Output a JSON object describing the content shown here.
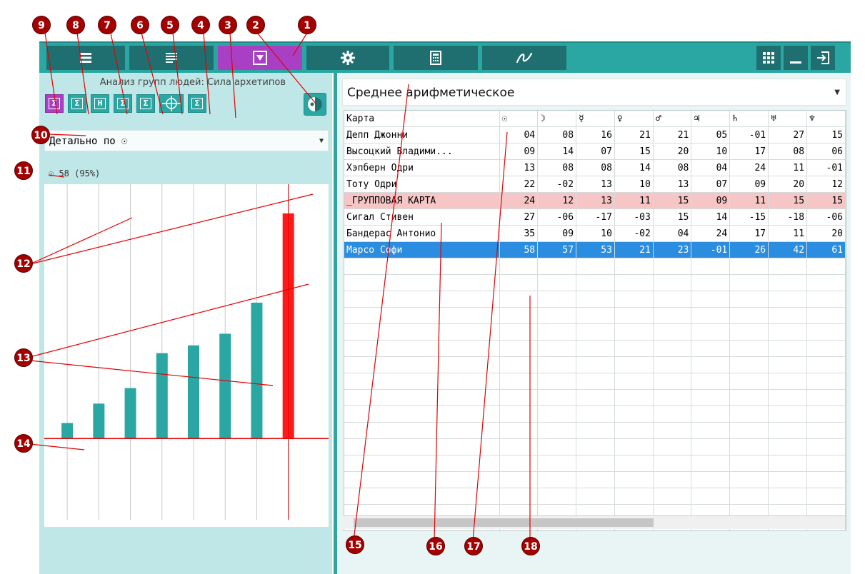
{
  "topbar": {
    "tabs": [
      {
        "icon": "list-icon"
      },
      {
        "icon": "list-lines-icon"
      },
      {
        "icon": "filter-box-icon"
      },
      {
        "icon": "gear-icon"
      },
      {
        "icon": "calculator-icon"
      },
      {
        "icon": "signature-icon"
      }
    ],
    "window_buttons": [
      "grid-icon",
      "minimize-icon",
      "exit-icon"
    ]
  },
  "left": {
    "title": "Анализ групп людей: Сила архетипов",
    "toolbar": [
      {
        "label": "Σ",
        "icon": "sum-icon"
      },
      {
        "label": "Σ",
        "icon": "sum-a-icon"
      },
      {
        "label": "H",
        "icon": "h-icon"
      },
      {
        "label": "Σ",
        "icon": "sum-box-icon"
      },
      {
        "label": "Σ",
        "icon": "sum-grid-icon"
      },
      {
        "label": "⊕",
        "icon": "crosshair-icon"
      },
      {
        "label": "Σ",
        "icon": "sum-bracket-icon"
      },
      {
        "label": "◉",
        "icon": "toggle-icon"
      }
    ],
    "dropdown": "Детально по ☉",
    "sublabel": "☉ 58 (95%)"
  },
  "chart_data": {
    "type": "bar",
    "values": [
      4,
      9,
      13,
      22,
      24,
      27,
      35,
      58
    ],
    "colors": [
      "#2aa7a3",
      "#2aa7a3",
      "#2aa7a3",
      "#2aa7a3",
      "#2aa7a3",
      "#2aa7a3",
      "#2aa7a3",
      "#ff1a1a"
    ],
    "ylim": [
      -20,
      60
    ]
  },
  "right": {
    "select": "Среднее арифметическое",
    "columns": [
      "Карта",
      "☉",
      "☽",
      "☿",
      "♀",
      "♂",
      "♃",
      "♄",
      "♅",
      "♆"
    ],
    "rows": [
      {
        "name": "Депп Джонни",
        "vals": [
          "04",
          "08",
          "16",
          "21",
          "21",
          "05",
          "-01",
          "27",
          "15"
        ],
        "kind": "normal"
      },
      {
        "name": "Высоцкий Владими...",
        "vals": [
          "09",
          "14",
          "07",
          "15",
          "20",
          "10",
          "17",
          "08",
          "06"
        ],
        "kind": "normal"
      },
      {
        "name": "Хэпберн Одри",
        "vals": [
          "13",
          "08",
          "08",
          "14",
          "08",
          "04",
          "24",
          "11",
          "-01"
        ],
        "kind": "normal"
      },
      {
        "name": "Тоту Одри",
        "vals": [
          "22",
          "-02",
          "13",
          "10",
          "13",
          "07",
          "09",
          "20",
          "12"
        ],
        "kind": "normal"
      },
      {
        "name": "_ГРУППОВАЯ КАРТА",
        "vals": [
          "24",
          "12",
          "13",
          "11",
          "15",
          "09",
          "11",
          "15",
          "15"
        ],
        "kind": "group"
      },
      {
        "name": "Сигал Стивен",
        "vals": [
          "27",
          "-06",
          "-17",
          "-03",
          "15",
          "14",
          "-15",
          "-18",
          "-06"
        ],
        "kind": "normal"
      },
      {
        "name": "Бандерас Антонио",
        "vals": [
          "35",
          "09",
          "10",
          "-02",
          "04",
          "24",
          "17",
          "11",
          "20"
        ],
        "kind": "normal"
      },
      {
        "name": "Марсо Софи",
        "vals": [
          "58",
          "57",
          "53",
          "21",
          "23",
          "-01",
          "26",
          "42",
          "61"
        ],
        "kind": "sel"
      }
    ]
  },
  "markers": [
    "1",
    "2",
    "3",
    "4",
    "5",
    "6",
    "7",
    "8",
    "9",
    "10",
    "11",
    "12",
    "13",
    "14",
    "15",
    "16",
    "17",
    "18"
  ],
  "colors": {
    "teal": "#2aa7a3",
    "dark_teal": "#1f6f71",
    "purple": "#a940c4",
    "marker": "#a40000",
    "selection": "#2b8de0",
    "group_row": "#f6c6c6"
  }
}
